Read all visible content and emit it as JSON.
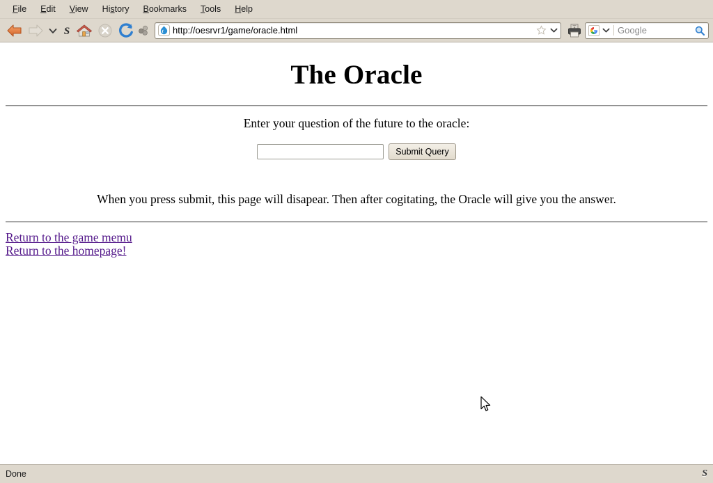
{
  "browser": {
    "menubar": [
      {
        "name": "file",
        "pre": "",
        "key": "F",
        "post": "ile"
      },
      {
        "name": "edit",
        "pre": "",
        "key": "E",
        "post": "dit"
      },
      {
        "name": "view",
        "pre": "",
        "key": "V",
        "post": "iew"
      },
      {
        "name": "history",
        "pre": "Hi",
        "key": "s",
        "post": "tory"
      },
      {
        "name": "bookmarks",
        "pre": "",
        "key": "B",
        "post": "ookmarks"
      },
      {
        "name": "tools",
        "pre": "",
        "key": "T",
        "post": "ools"
      },
      {
        "name": "help",
        "pre": "",
        "key": "H",
        "post": "elp"
      }
    ],
    "toolbar": {
      "back": "back-arrow-icon",
      "forward": "forward-arrow-icon",
      "history_dropdown": "chevron-down-icon",
      "scrapbook": "scrapbook-s-icon",
      "home": "home-icon",
      "stop": "stop-icon",
      "reload": "reload-icon",
      "cluster": "molecule-cluster-icon",
      "print": "printer-icon"
    },
    "urlbar": {
      "favicon": "drupal-droplet-favicon",
      "url": "http://oesrvr1/game/oracle.html",
      "star": "bookmark-star-icon",
      "chevron": "chevron-down-icon"
    },
    "search": {
      "engine_icon": "google-logo-icon",
      "chevron": "chevron-down-icon",
      "placeholder": "Google",
      "go_icon": "magnifier-icon"
    },
    "statusbar": {
      "text": "Done",
      "right_icon": "scrapbook-s-icon"
    }
  },
  "page": {
    "title": "The Oracle",
    "prompt": "Enter your question of the future to the oracle:",
    "query_value": "",
    "query_placeholder": "",
    "submit_label": "Submit Query",
    "note": "When you press submit, this page will disapear. Then after cogitating, the Oracle will give you the answer.",
    "links": [
      {
        "name": "return-to-game-menu",
        "label": "Return to the game memu"
      },
      {
        "name": "return-to-homepage",
        "label": "Return to the homepage!"
      }
    ]
  },
  "colors": {
    "chrome": "#ded8cd",
    "content": "#ffffff",
    "link": "#551a8b",
    "rule": "#8c8c8c"
  }
}
